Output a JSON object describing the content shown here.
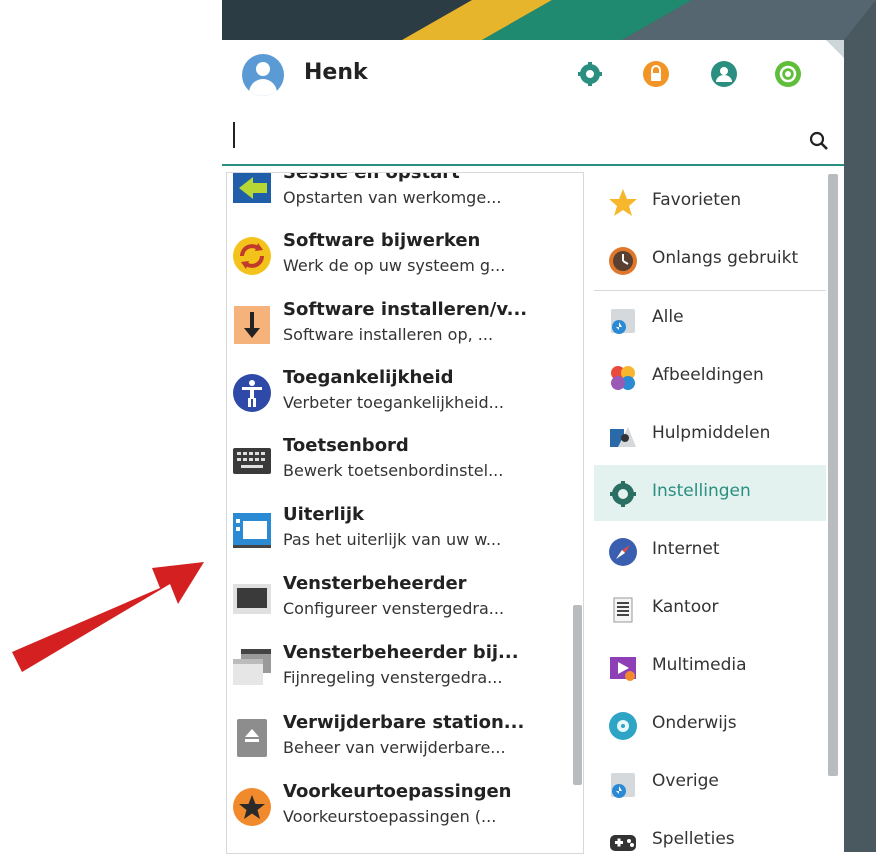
{
  "user": {
    "name": "Henk"
  },
  "search": {
    "value": "",
    "placeholder": ""
  },
  "header_buttons": [
    {
      "name": "settings-icon",
      "color": "#2a8f80"
    },
    {
      "name": "lock-icon",
      "color": "#f29426"
    },
    {
      "name": "user-icon",
      "color": "#2a8f80"
    },
    {
      "name": "power-icon",
      "color": "#5fbf3a"
    }
  ],
  "apps": [
    {
      "title": "Sessie en opstart",
      "desc": "Opstarten van werkomge...",
      "icon": "session-icon"
    },
    {
      "title": "Software bijwerken",
      "desc": "Werk de op uw systeem g...",
      "icon": "update-icon"
    },
    {
      "title": "Software installeren/v...",
      "desc": "Software installeren op, ...",
      "icon": "install-icon"
    },
    {
      "title": "Toegankelijkheid",
      "desc": "Verbeter toegankelijkheid...",
      "icon": "accessibility-icon"
    },
    {
      "title": "Toetsenbord",
      "desc": "Bewerk toetsenbordinstel...",
      "icon": "keyboard-icon"
    },
    {
      "title": "Uiterlijk",
      "desc": "Pas het uiterlijk van uw w...",
      "icon": "appearance-icon"
    },
    {
      "title": "Vensterbeheerder",
      "desc": "Configureer venstergedra...",
      "icon": "window-manager-icon"
    },
    {
      "title": "Vensterbeheerder bij...",
      "desc": "Fijnregeling venstergedra...",
      "icon": "window-tweaks-icon"
    },
    {
      "title": "Verwijderbare station...",
      "desc": "Beheer van verwijderbare...",
      "icon": "removable-drive-icon"
    },
    {
      "title": "Voorkeurtoepassingen",
      "desc": "Voorkeurstoepassingen (...",
      "icon": "preferred-apps-icon"
    }
  ],
  "categories": [
    {
      "label": "Favorieten",
      "icon": "star-icon"
    },
    {
      "label": "Onlangs gebruikt",
      "icon": "clock-icon"
    },
    {
      "label": "Alle",
      "icon": "all-icon"
    },
    {
      "label": "Afbeeldingen",
      "icon": "graphics-icon"
    },
    {
      "label": "Hulpmiddelen",
      "icon": "tools-icon"
    },
    {
      "label": "Instellingen",
      "icon": "settings-icon",
      "active": true
    },
    {
      "label": "Internet",
      "icon": "internet-icon"
    },
    {
      "label": "Kantoor",
      "icon": "office-icon"
    },
    {
      "label": "Multimedia",
      "icon": "multimedia-icon"
    },
    {
      "label": "Onderwijs",
      "icon": "education-icon"
    },
    {
      "label": "Overige",
      "icon": "other-icon"
    },
    {
      "label": "Spelleties",
      "icon": "games-icon"
    }
  ],
  "colors": {
    "accent": "#2a8f80",
    "arrow": "#d42020"
  }
}
